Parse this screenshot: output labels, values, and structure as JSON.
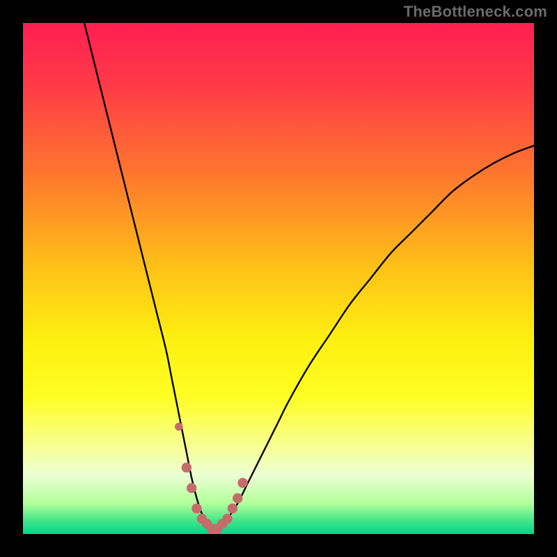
{
  "watermark": "TheBottleneck.com",
  "colors": {
    "frame_bg": "#000000",
    "curve": "#000000",
    "marker": "#c66b6b",
    "gradient_stops": [
      {
        "offset": 0.0,
        "color": "#ff1f52"
      },
      {
        "offset": 0.12,
        "color": "#ff3a48"
      },
      {
        "offset": 0.3,
        "color": "#fe782d"
      },
      {
        "offset": 0.48,
        "color": "#fec217"
      },
      {
        "offset": 0.62,
        "color": "#fdf011"
      },
      {
        "offset": 0.73,
        "color": "#fefe22"
      },
      {
        "offset": 0.82,
        "color": "#f8ff8a"
      },
      {
        "offset": 0.885,
        "color": "#ecffd4"
      },
      {
        "offset": 0.94,
        "color": "#b2ff9a"
      },
      {
        "offset": 0.975,
        "color": "#41e58a"
      },
      {
        "offset": 1.0,
        "color": "#00d688"
      }
    ]
  },
  "chart_data": {
    "type": "line",
    "title": "",
    "xlabel": "",
    "ylabel": "",
    "xlim": [
      0,
      100
    ],
    "ylim": [
      0,
      100
    ],
    "grid": false,
    "series": [
      {
        "name": "bottleneck-curve",
        "x": [
          12,
          14,
          16,
          18,
          20,
          22,
          24,
          26,
          28,
          29,
          30,
          31,
          32,
          33,
          34,
          35,
          36,
          37,
          38,
          39,
          40,
          42,
          44,
          46,
          48,
          50,
          52,
          56,
          60,
          64,
          68,
          72,
          76,
          80,
          84,
          88,
          92,
          96,
          100
        ],
        "y": [
          100,
          92,
          84,
          76,
          68,
          60,
          52,
          44,
          36,
          31,
          26,
          21,
          16,
          11,
          7,
          4,
          2,
          1,
          1,
          2,
          3,
          6,
          10,
          14,
          18,
          22,
          26,
          33,
          39,
          45,
          50,
          55,
          59,
          63,
          67,
          70,
          72.5,
          74.5,
          76
        ]
      }
    ],
    "markers": {
      "name": "highlight-points",
      "x": [
        30.5,
        32,
        33,
        34,
        35,
        36,
        37,
        38,
        39,
        40,
        41,
        42,
        43
      ],
      "y": [
        21,
        13,
        9,
        5,
        3,
        2,
        1,
        1,
        2,
        3,
        5,
        7,
        10
      ],
      "r": [
        3.6,
        4.5,
        4.5,
        4.5,
        4.5,
        4.5,
        4.5,
        4.5,
        4.5,
        4.5,
        4.5,
        4.5,
        4.5
      ]
    }
  }
}
